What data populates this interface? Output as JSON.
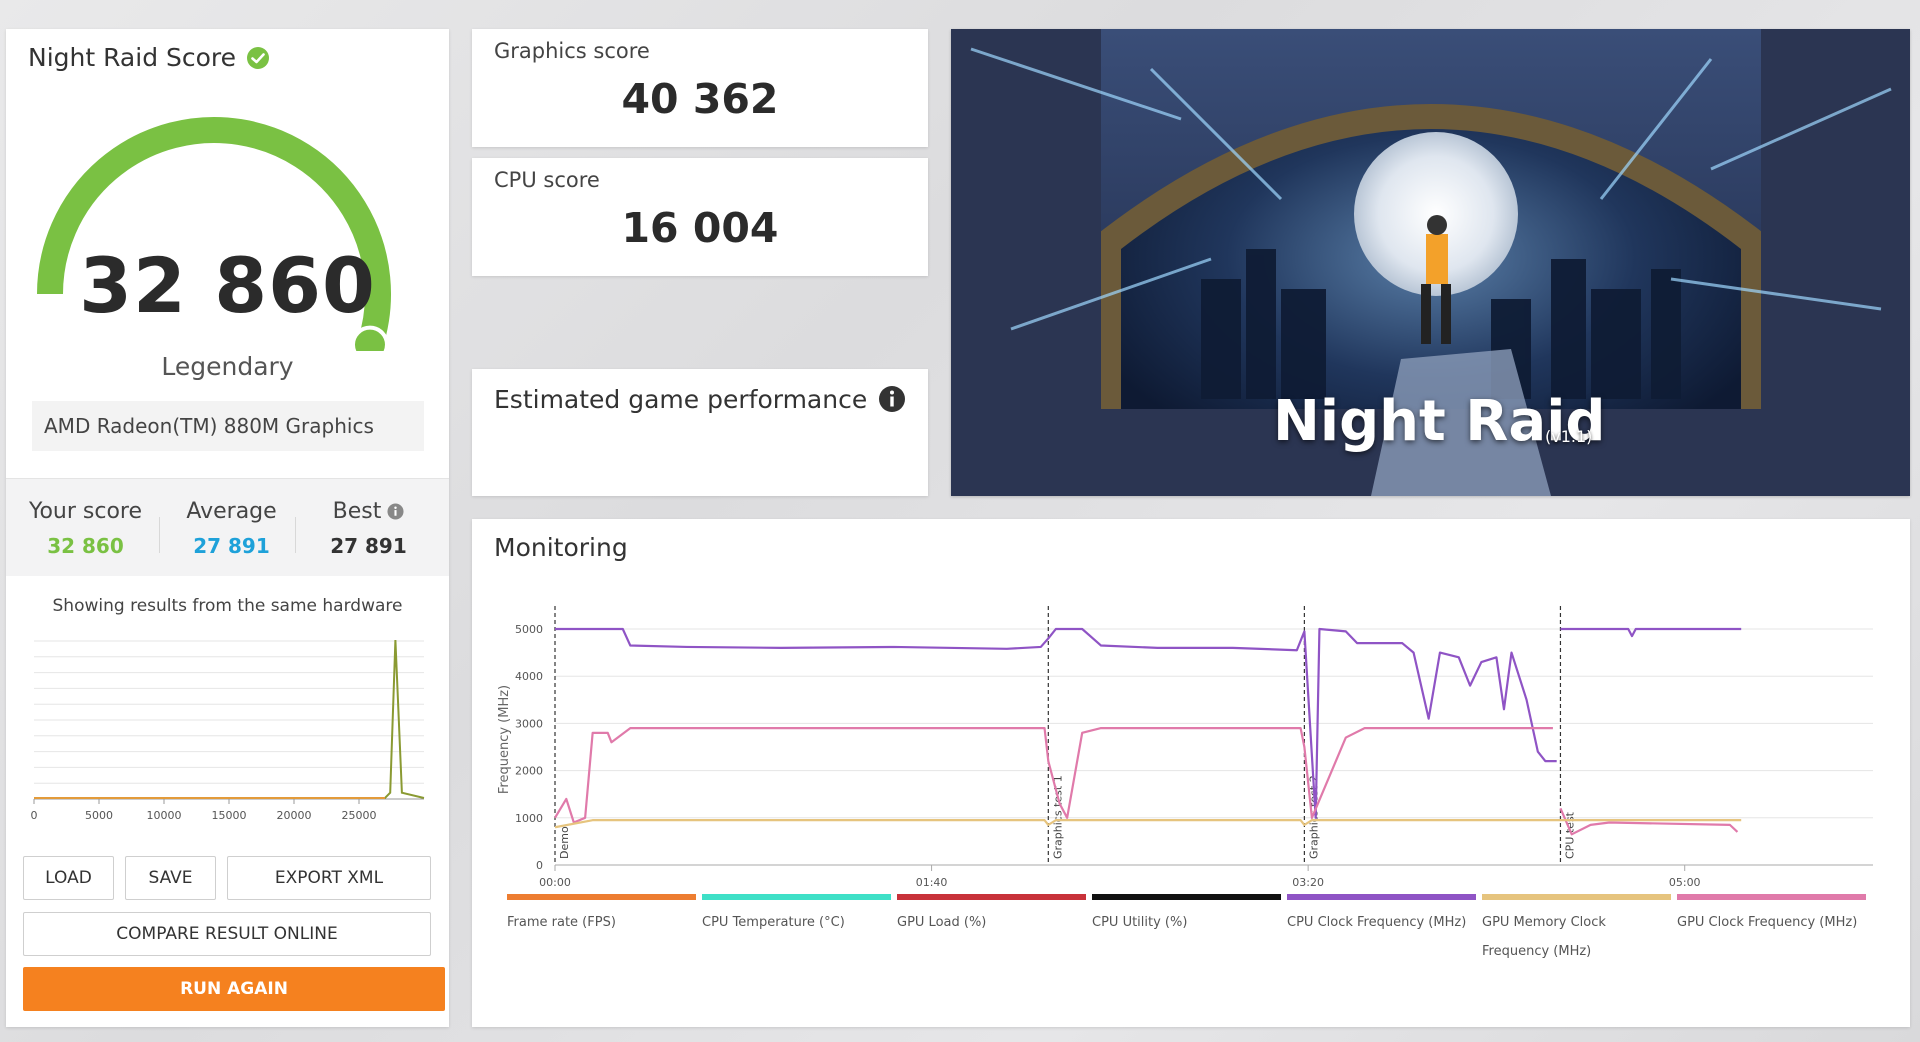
{
  "score_panel": {
    "title": "Night Raid Score",
    "main_score": "32 860",
    "rank": "Legendary",
    "gpu_name": "AMD Radeon(TM) 880M Graphics",
    "score_fraction": 1.0,
    "compare": {
      "your_label": "Your score",
      "your_value": "32 860",
      "avg_label": "Average",
      "avg_value": "27 891",
      "best_label": "Best",
      "best_value": "27 891"
    },
    "same_hw_text": "Showing results from the same hardware",
    "buttons": {
      "load": "LOAD",
      "save": "SAVE",
      "export": "EXPORT XML",
      "compare": "COMPARE RESULT ONLINE",
      "run": "RUN AGAIN"
    },
    "colors": {
      "green": "#7ac143",
      "avg_blue": "#1ea1d9",
      "run_orange": "#f5811f"
    }
  },
  "cards": {
    "graphics_label": "Graphics score",
    "graphics_value": "40 362",
    "cpu_label": "CPU score",
    "cpu_value": "16 004",
    "egp_label": "Estimated game performance"
  },
  "banner": {
    "title": "Night Raid",
    "version": "(v1.1)"
  },
  "monitoring": {
    "title": "Monitoring",
    "legend": [
      {
        "label": "Frame rate (FPS)",
        "color": "#ed7d31"
      },
      {
        "label": "CPU Temperature (°C)",
        "color": "#3ee0c7"
      },
      {
        "label": "GPU Load (%)",
        "color": "#c8323a"
      },
      {
        "label": "CPU Utility (%)",
        "color": "#111111"
      },
      {
        "label": "CPU Clock Frequency (MHz)",
        "color": "#8f54c5"
      },
      {
        "label": "GPU Memory Clock Frequency (MHz)",
        "color": "#e6c47e"
      },
      {
        "label": "GPU Clock Frequency (MHz)",
        "color": "#e07aaa"
      }
    ]
  },
  "chart_data": [
    {
      "type": "line",
      "xlim": [
        0,
        30000
      ],
      "x_ticks": [
        0,
        5000,
        10000,
        15000,
        20000,
        25000
      ],
      "series": [
        {
          "x": [
            0,
            27000,
            27400,
            27800,
            28300,
            30000
          ],
          "values": [
            0,
            0,
            1,
            30,
            1,
            0
          ]
        }
      ]
    },
    {
      "type": "line",
      "ylabel": "Frequency (MHz)",
      "ylim": [
        0,
        5000
      ],
      "y_ticks": [
        0,
        1000,
        2000,
        3000,
        4000,
        5000
      ],
      "xlim": [
        0,
        350
      ],
      "x_tick_labels": [
        "00:00",
        "01:40",
        "03:20",
        "05:00"
      ],
      "x_tick_values": [
        0,
        100,
        200,
        300
      ],
      "markers": [
        {
          "x": 0,
          "label": "Demo"
        },
        {
          "x": 131,
          "label": "Graphics test 1"
        },
        {
          "x": 199,
          "label": "Graphics test 2"
        },
        {
          "x": 267,
          "label": "CPU test"
        }
      ],
      "series": [
        {
          "color": "#8f54c5",
          "segments": [
            [
              [
                0,
                5000
              ],
              [
                18,
                5000
              ],
              [
                20,
                4650
              ],
              [
                35,
                4620
              ],
              [
                60,
                4600
              ],
              [
                90,
                4620
              ],
              [
                120,
                4580
              ],
              [
                129,
                4620
              ],
              [
                131,
                4800
              ],
              [
                133,
                5000
              ],
              [
                140,
                5000
              ],
              [
                145,
                4650
              ],
              [
                160,
                4600
              ],
              [
                180,
                4600
              ],
              [
                197,
                4550
              ],
              [
                199,
                4950
              ],
              [
                202,
                1000
              ],
              [
                203,
                5000
              ],
              [
                210,
                4950
              ],
              [
                213,
                4700
              ],
              [
                225,
                4700
              ],
              [
                228,
                4500
              ],
              [
                232,
                3100
              ],
              [
                235,
                4500
              ],
              [
                240,
                4400
              ],
              [
                243,
                3800
              ],
              [
                246,
                4300
              ],
              [
                250,
                4400
              ],
              [
                252,
                3300
              ],
              [
                254,
                4500
              ],
              [
                258,
                3500
              ],
              [
                261,
                2400
              ],
              [
                263,
                2200
              ],
              [
                266,
                2200
              ]
            ],
            [
              [
                267,
                5000
              ],
              [
                285,
                5000
              ],
              [
                286,
                4850
              ],
              [
                287,
                5000
              ],
              [
                315,
                5000
              ]
            ]
          ]
        },
        {
          "color": "#e07aaa",
          "segments": [
            [
              [
                0,
                1000
              ],
              [
                3,
                1400
              ],
              [
                5,
                900
              ],
              [
                8,
                1000
              ],
              [
                10,
                2800
              ],
              [
                14,
                2800
              ],
              [
                15,
                2600
              ],
              [
                20,
                2900
              ],
              [
                60,
                2900
              ],
              [
                130,
                2900
              ],
              [
                131,
                2200
              ],
              [
                134,
                1300
              ],
              [
                136,
                1000
              ],
              [
                140,
                2800
              ],
              [
                145,
                2900
              ],
              [
                198,
                2900
              ],
              [
                199,
                2500
              ],
              [
                201,
                1000
              ],
              [
                210,
                2700
              ],
              [
                215,
                2900
              ],
              [
                260,
                2900
              ],
              [
                265,
                2900
              ]
            ],
            [
              [
                267,
                1200
              ],
              [
                270,
                650
              ],
              [
                275,
                850
              ],
              [
                280,
                900
              ],
              [
                312,
                850
              ],
              [
                314,
                700
              ]
            ]
          ]
        },
        {
          "color": "#e6c47e",
          "segments": [
            [
              [
                0,
                800
              ],
              [
                10,
                950
              ],
              [
                130,
                950
              ],
              [
                131,
                850
              ],
              [
                133,
                950
              ],
              [
                198,
                950
              ],
              [
                199,
                850
              ],
              [
                201,
                950
              ],
              [
                315,
                950
              ]
            ]
          ]
        }
      ]
    }
  ]
}
